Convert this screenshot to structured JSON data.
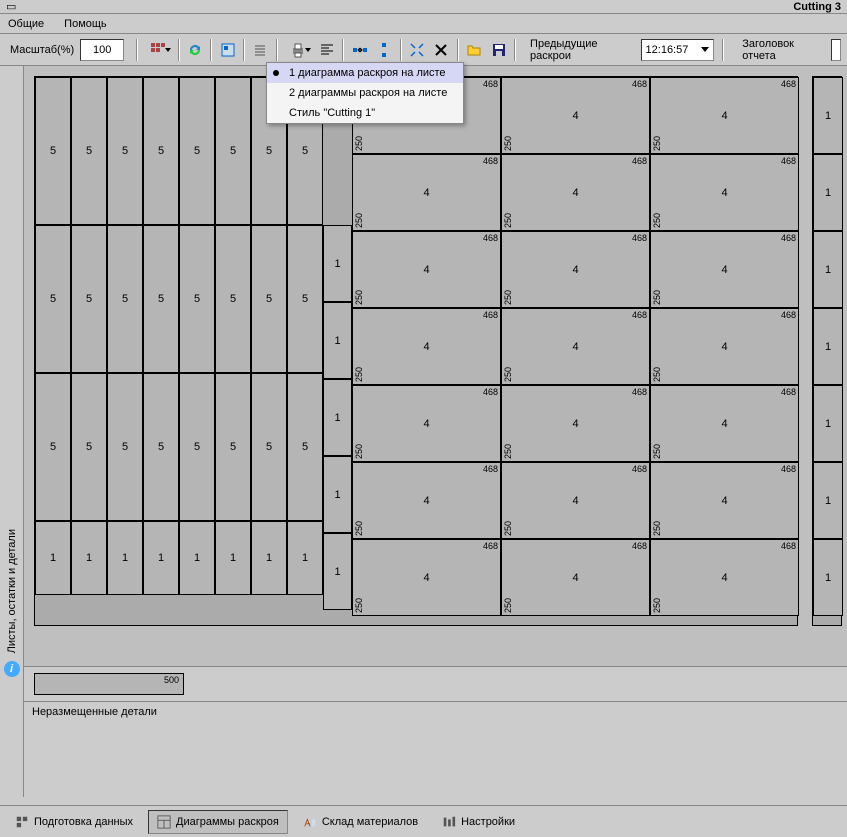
{
  "title": "Cutting 3",
  "menu": {
    "opt1": "Общие",
    "opt2": "Помощь"
  },
  "toolbar": {
    "zoom_label": "Масштаб(%)",
    "zoom_value": "100",
    "prev_label": "Предыдущие раскрои",
    "time": "12:16:57",
    "report_label": "Заголовок отчета"
  },
  "sidebar": {
    "label": "Листы, остатки и детали"
  },
  "dropdown": {
    "item1": "1 диаграмма раскроя на листе",
    "item2": "2 диаграммы раскроя на листе",
    "item3": "Стиль \"Cutting 1\""
  },
  "unplaced": {
    "label": "Неразмещенные детали"
  },
  "tabs": {
    "t1": "Подготовка данных",
    "t2": "Диаграммы раскроя",
    "t3": "Склад материалов",
    "t4": "Настройки"
  },
  "small_sheet_dim": "500",
  "pieces": {
    "p5": "5",
    "p1": "1",
    "p4": "4",
    "d468": "468",
    "d250": "250"
  }
}
